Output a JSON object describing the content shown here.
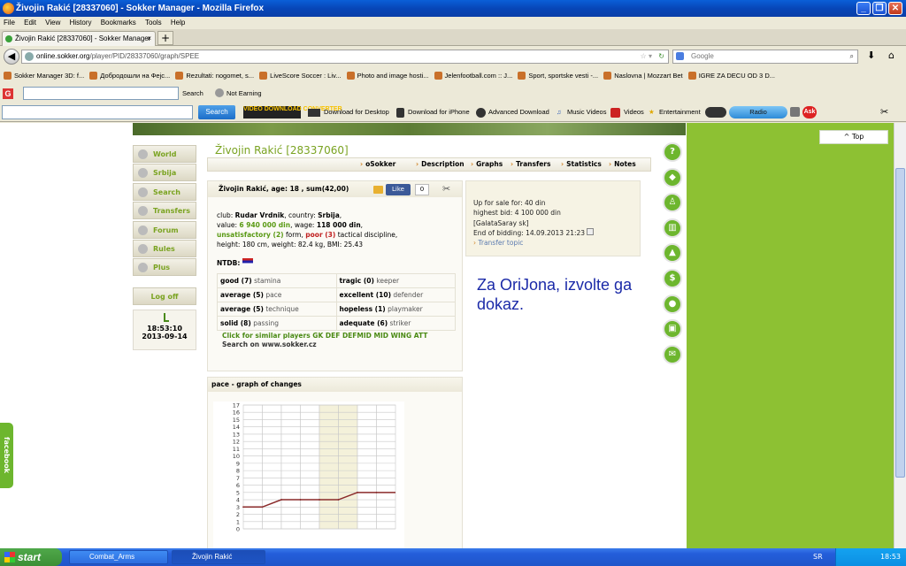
{
  "window": {
    "title": "Živojin Rakić [28337060] - Sokker Manager - Mozilla Firefox",
    "buttons": [
      "_",
      "❐",
      "✕"
    ]
  },
  "menu": [
    "File",
    "Edit",
    "View",
    "History",
    "Bookmarks",
    "Tools",
    "Help"
  ],
  "tab": {
    "label": "Živojin Rakić [28337060] - Sokker Manager",
    "close": "×",
    "new": "+"
  },
  "nav": {
    "url_host": "online.sokker.org",
    "url_path": "/player/PID/28337060/graph/SPEE",
    "search_placeholder": "Google"
  },
  "bookmarks": [
    "Sokker Manager 3D: f...",
    "Добродошли на Фејс...",
    "Rezultati: nogomet, s...",
    "LiveScore Soccer : Liv...",
    "Photo and image hosti...",
    "Jelenfootball.com :: J...",
    "Sport, sportske vesti -...",
    "Naslovna | Mozzart Bet",
    "IGRE ZA DECU OD 3 D..."
  ],
  "toolbar2": {
    "search_label": "Search",
    "not_earning": "Not Earning"
  },
  "toolbar3": {
    "search_button": "Search",
    "converter": "VIDEO DOWNLOAD CONVERTER",
    "items": [
      "Download for Desktop",
      "Download for iPhone",
      "Advanced Download",
      "Music Videos",
      "Videos",
      "Entertainment"
    ],
    "radio": "Radio"
  },
  "sidenav": [
    "World",
    "Srbija",
    "Search",
    "Transfers",
    "Forum",
    "Rules",
    "Plus"
  ],
  "logout": "Log off",
  "clock": {
    "time": "18:53:10",
    "date": "2013-09-14"
  },
  "player": {
    "title": "Živojin Rakić [28337060]",
    "tabs": [
      "oSokker",
      "Description",
      "Graphs",
      "Transfers",
      "Statistics",
      "Notes"
    ],
    "header": "Živojin Rakić, age: 18 , sum(42,00)",
    "like": "Like",
    "like_count": "0",
    "club_label": "club:",
    "club": "Rudar Vrdnik",
    "country_label": ", country:",
    "country": "Srbija",
    "value_label": "value:",
    "value": "6 940 000 din",
    "wage_label": ", wage:",
    "wage": "118 000 din",
    "form_word": "unsatisfactory (2)",
    "form_label": "form,",
    "discipline_word": "poor (3)",
    "discipline_label": "tactical discipline,",
    "height_line": "height: 180 cm, weight: 82.4 kg, BMI: 25.43",
    "ntdb": "NTDB:",
    "skills": [
      {
        "level": "good (7)",
        "name": "stamina"
      },
      {
        "level": "tragic (0)",
        "name": "keeper"
      },
      {
        "level": "average (5)",
        "name": "pace"
      },
      {
        "level": "excellent (10)",
        "name": "defender"
      },
      {
        "level": "average (5)",
        "name": "technique"
      },
      {
        "level": "hopeless (1)",
        "name": "playmaker"
      },
      {
        "level": "solid (8)",
        "name": "passing"
      },
      {
        "level": "adequate (6)",
        "name": "striker"
      }
    ],
    "similar": "Click for similar players GK DEF DEFMID MID WING ATT",
    "search_sokker": "Search on www.sokker.cz"
  },
  "sale": {
    "for_sale": "Up for sale for: 40 din",
    "highest_bid": "highest bid: 4 100 000 din",
    "bidder": "[GalataSaray sk]",
    "end": "End of bidding: 14.09.2013 21:23",
    "topic": "Transfer topic"
  },
  "note": "Za OriJona, izvolte ga dokaz.",
  "graph": {
    "title": "pace - graph of changes"
  },
  "chart_data": {
    "type": "line",
    "title": "pace - graph of changes",
    "y_ticks": [
      0,
      1,
      2,
      3,
      4,
      5,
      6,
      7,
      8,
      9,
      10,
      11,
      12,
      13,
      14,
      15,
      16,
      17
    ],
    "ylim": [
      0,
      17
    ],
    "values": [
      3,
      3,
      4,
      4,
      4,
      4,
      5,
      5
    ],
    "grid": true
  },
  "top_button": "^ Top",
  "facebook_tab": "facebook",
  "taskbar": {
    "start": "start",
    "tasks": [
      "Combat_Arms",
      "Živojin Rakić [283370..."
    ],
    "tray_lang": "SR",
    "tray_time": "18:53"
  }
}
